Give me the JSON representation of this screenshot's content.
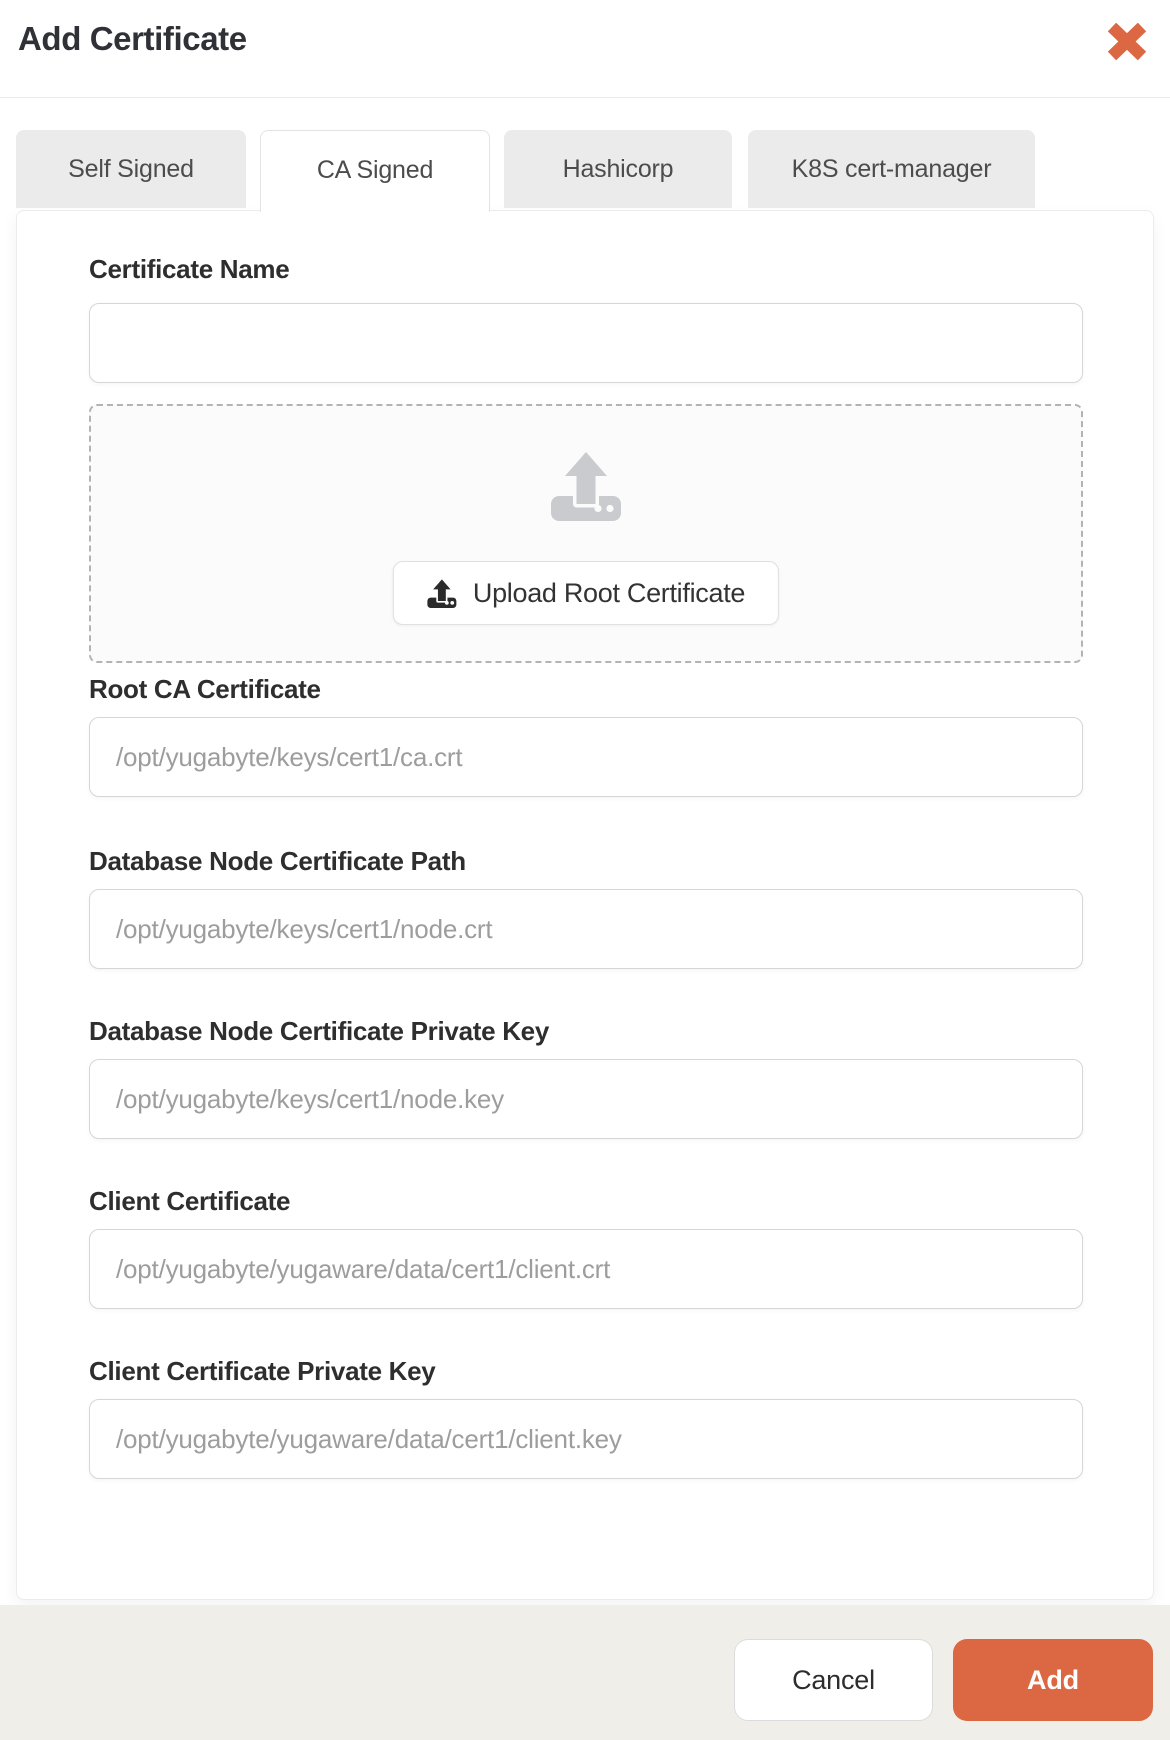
{
  "header": {
    "title": "Add Certificate"
  },
  "tabs": [
    {
      "label": "Self Signed",
      "active": false
    },
    {
      "label": "CA Signed",
      "active": true
    },
    {
      "label": "Hashicorp",
      "active": false
    },
    {
      "label": "K8S cert-manager",
      "active": false
    }
  ],
  "form": {
    "name_label": "Certificate Name",
    "name_value": "",
    "upload_button_label": "Upload Root Certificate",
    "fields": [
      {
        "label": "Root CA Certificate",
        "placeholder": "/opt/yugabyte/keys/cert1/ca.crt"
      },
      {
        "label": "Database Node Certificate Path",
        "placeholder": "/opt/yugabyte/keys/cert1/node.crt"
      },
      {
        "label": "Database Node Certificate Private Key",
        "placeholder": "/opt/yugabyte/keys/cert1/node.key"
      },
      {
        "label": "Client Certificate",
        "placeholder": "/opt/yugabyte/yugaware/data/cert1/client.crt"
      },
      {
        "label": "Client Certificate Private Key",
        "placeholder": "/opt/yugabyte/yugaware/data/cert1/client.key"
      }
    ]
  },
  "footer": {
    "cancel_label": "Cancel",
    "add_label": "Add"
  },
  "icons": {
    "close": "x-mark",
    "upload": "upload-tray"
  },
  "colors": {
    "accent": "#dc6843",
    "footer_bg": "#f0eee8",
    "inactive_tab_bg": "#ebebeb",
    "upload_icon_gray": "#c9cbcf"
  }
}
